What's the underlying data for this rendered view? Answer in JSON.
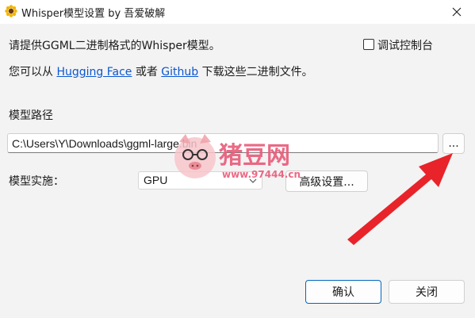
{
  "window": {
    "title": "Whisper模型设置 by 吾爱破解",
    "app_icon": "sunflower-icon",
    "close_icon": "close-icon"
  },
  "body": {
    "intro_text": "请提供GGML二进制格式的Whisper模型。",
    "debug_console_label": "调试控制台",
    "debug_console_checked": false,
    "download_prefix": "您可以从",
    "link_hugging_face": "Hugging Face",
    "or_text": "或者",
    "link_github": "Github",
    "download_suffix": "下载这些二进制文件。",
    "model_path_label": "模型路径",
    "model_path_value": "C:\\Users\\Y\\Downloads\\ggml-large.bin",
    "browse_button": "...",
    "implementation_label": "模型实施：",
    "implementation_value": "GPU",
    "advanced_button": "高级设置...",
    "ok_button": "确认",
    "close_button": "关闭"
  },
  "overlay": {
    "watermark_title": "猪豆网",
    "watermark_url": "www.97444.cn",
    "accent_red": "#e8232a",
    "watermark_pink": "#f0a0a8"
  }
}
